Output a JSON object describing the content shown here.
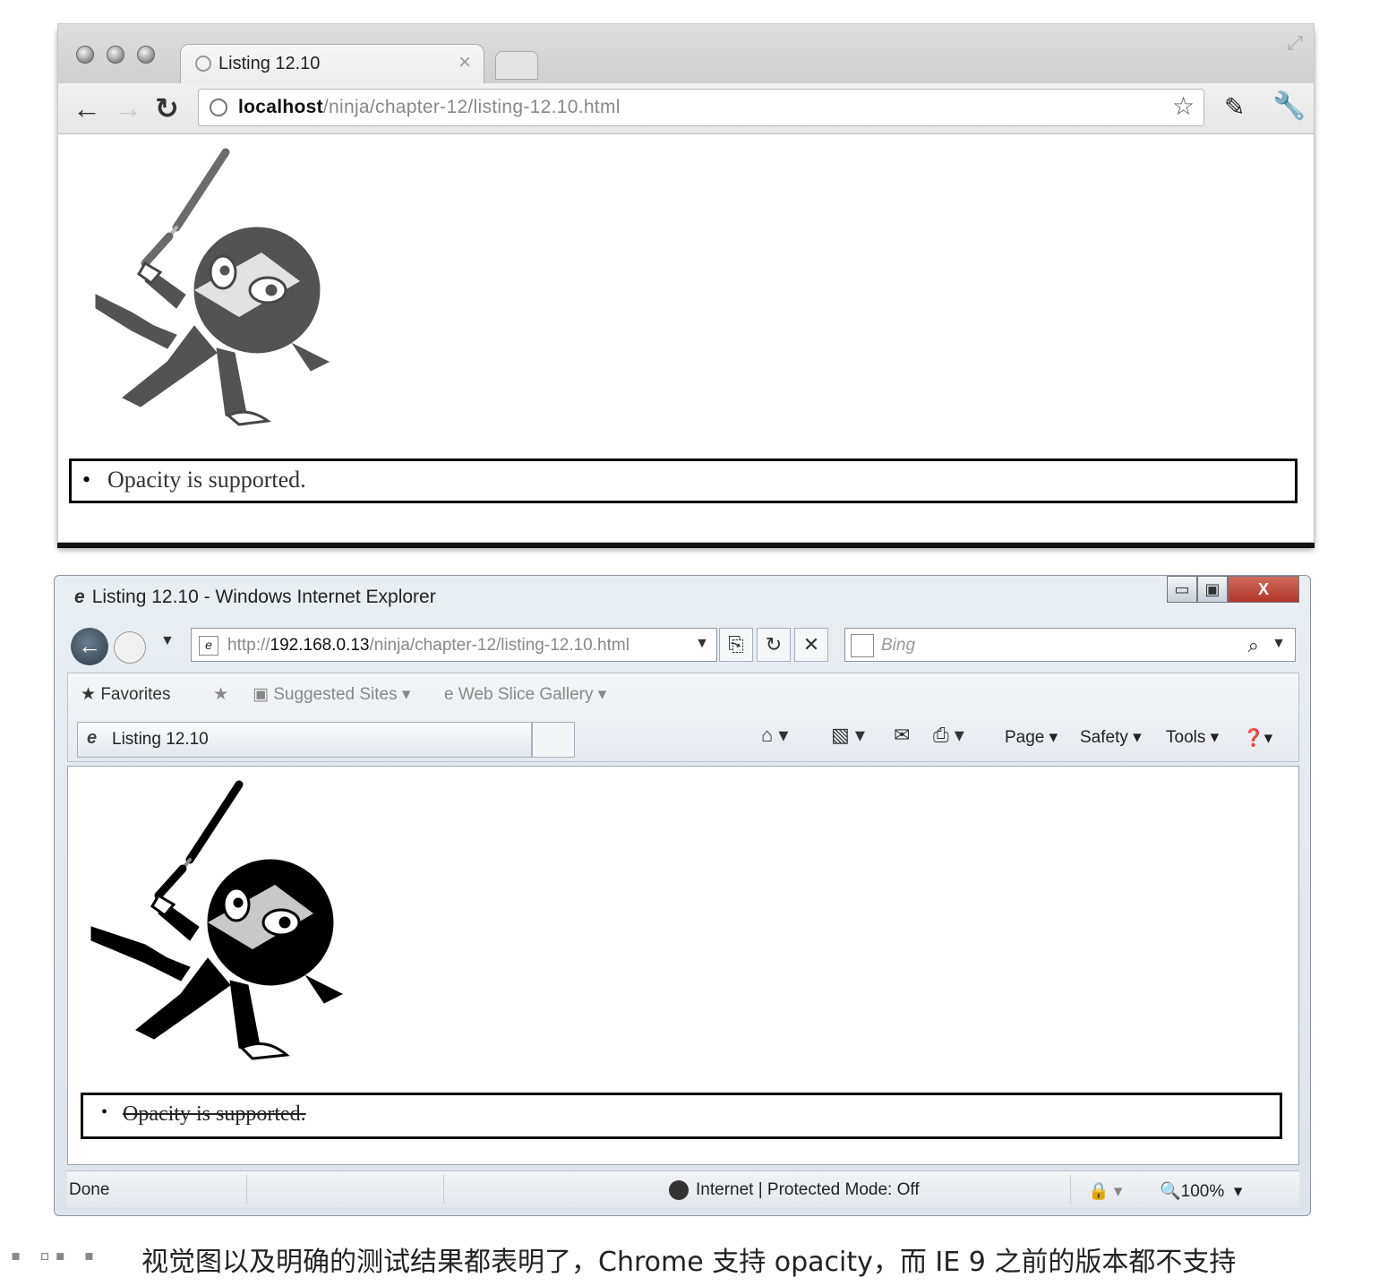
{
  "chrome": {
    "tab_title": "Listing 12.10",
    "tab_close": "×",
    "url_host": "localhost",
    "url_path": "/ninja/chapter-12/listing-12.10.html",
    "icons": [
      "back-arrow-icon",
      "forward-arrow-icon",
      "reload-icon",
      "globe-icon",
      "star-icon",
      "page-menu-icon",
      "wrench-icon"
    ],
    "result_text": "Opacity is supported."
  },
  "ie": {
    "window_title": "Listing 12.10 - Windows Internet Explorer",
    "window_controls": {
      "minimize": "▭",
      "maximize": "▣",
      "close": "X"
    },
    "url_scheme": "http://",
    "url_host": "192.168.0.13",
    "url_path": "/ninja/chapter-12/listing-12.10.html",
    "search_placeholder": "Bing",
    "favorites_label": "Favorites",
    "suggested_sites_label": "Suggested Sites",
    "web_slice_label": "Web Slice Gallery",
    "tab_title": "Listing 12.10",
    "page_menu": "Page",
    "safety_menu": "Safety",
    "tools_menu": "Tools",
    "status_done": "Done",
    "status_zone": "Internet | Protected Mode: Off",
    "status_zoom": "100%",
    "result_text": "Opacity is supported."
  },
  "caption": {
    "figure_label": "▪ ▫▪ ▪",
    "text": "视觉图以及明确的测试结果都表明了，Chrome 支持 opacity，而 IE 9 之前的版本都不支持"
  }
}
